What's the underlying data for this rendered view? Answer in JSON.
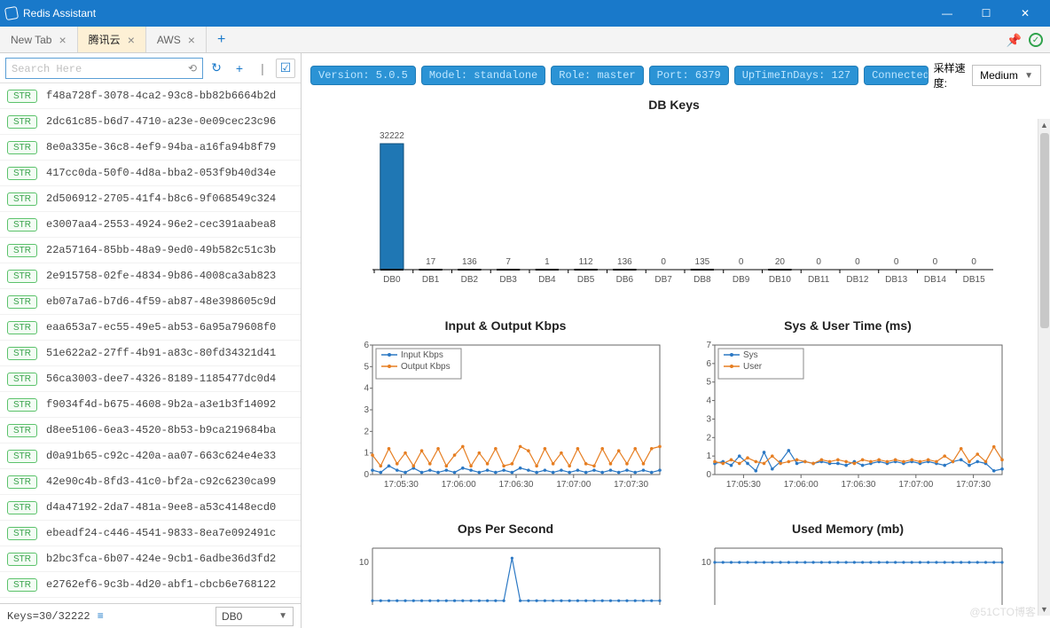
{
  "window": {
    "title": "Redis Assistant"
  },
  "tabs": [
    {
      "label": "New Tab",
      "active": false
    },
    {
      "label": "腾讯云",
      "active": true
    },
    {
      "label": "AWS",
      "active": false
    }
  ],
  "search": {
    "placeholder": "Search Here"
  },
  "keys_type_tag": "STR",
  "keys": [
    "f48a728f-3078-4ca2-93c8-bb82b6664b2d",
    "2dc61c85-b6d7-4710-a23e-0e09cec23c96",
    "8e0a335e-36c8-4ef9-94ba-a16fa94b8f79",
    "417cc0da-50f0-4d8a-bba2-053f9b40d34e",
    "2d506912-2705-41f4-b8c6-9f068549c324",
    "e3007aa4-2553-4924-96e2-cec391aabea8",
    "22a57164-85bb-48a9-9ed0-49b582c51c3b",
    "2e915758-02fe-4834-9b86-4008ca3ab823",
    "eb07a7a6-b7d6-4f59-ab87-48e398605c9d",
    "eaa653a7-ec55-49e5-ab53-6a95a79608f0",
    "51e622a2-27ff-4b91-a83c-80fd34321d41",
    "56ca3003-dee7-4326-8189-1185477dc0d4",
    "f9034f4d-b675-4608-9b2a-a3e1b3f14092",
    "d8ee5106-6ea3-4520-8b53-b9ca219684ba",
    "d0a91b65-c92c-420a-aa07-663c624e4e33",
    "42e90c4b-8fd3-41c0-bf2a-c92c6230ca99",
    "d4a47192-2da7-481a-9ee8-a53c4148ecd0",
    "ebeadf24-c446-4541-9833-8ea7e092491c",
    "b2bc3fca-6b07-424e-9cb1-6adbe36d3fd2",
    "e2762ef6-9c3b-4d20-abf1-cbcb6e768122"
  ],
  "status": {
    "keys_label": "Keys=30/32222",
    "db_selected": "DB0"
  },
  "badges": {
    "version": "Version: 5.0.5",
    "model": "Model: standalone",
    "role": "Role: master",
    "port": "Port: 6379",
    "uptime": "UpTimeInDays: 127",
    "connected": "ConnectedCli"
  },
  "sample": {
    "label": "采样速度:",
    "value": "Medium"
  },
  "charts": {
    "dbkeys": {
      "title": "DB Keys",
      "type": "bar",
      "categories": [
        "DB0",
        "DB1",
        "DB2",
        "DB3",
        "DB4",
        "DB5",
        "DB6",
        "DB7",
        "DB8",
        "DB9",
        "DB10",
        "DB11",
        "DB12",
        "DB13",
        "DB14",
        "DB15"
      ],
      "values": [
        32222,
        17,
        136,
        7,
        1,
        112,
        136,
        0,
        135,
        0,
        20,
        0,
        0,
        0,
        0,
        0
      ]
    },
    "io": {
      "title": "Input & Output Kbps",
      "type": "line",
      "x_ticks": [
        "17:05:30",
        "17:06:00",
        "17:06:30",
        "17:07:00",
        "17:07:30"
      ],
      "ylim": [
        0,
        6
      ],
      "series": [
        {
          "name": "Input Kbps",
          "color": "#2B78C4",
          "values": [
            0.2,
            0.1,
            0.4,
            0.2,
            0.1,
            0.3,
            0.1,
            0.2,
            0.1,
            0.2,
            0.1,
            0.3,
            0.2,
            0.1,
            0.2,
            0.1,
            0.2,
            0.1,
            0.3,
            0.2,
            0.1,
            0.2,
            0.1,
            0.2,
            0.1,
            0.2,
            0.1,
            0.2,
            0.1,
            0.2,
            0.1,
            0.2,
            0.1,
            0.2,
            0.1,
            0.2
          ]
        },
        {
          "name": "Output Kbps",
          "color": "#E67E22",
          "values": [
            0.9,
            0.4,
            1.2,
            0.5,
            1.0,
            0.4,
            1.1,
            0.5,
            1.2,
            0.4,
            0.9,
            1.3,
            0.4,
            1.0,
            0.5,
            1.2,
            0.4,
            0.5,
            1.3,
            1.1,
            0.4,
            1.2,
            0.5,
            1.0,
            0.4,
            1.2,
            0.5,
            0.4,
            1.2,
            0.5,
            1.1,
            0.5,
            1.2,
            0.5,
            1.2,
            1.3
          ]
        }
      ]
    },
    "cpu": {
      "title": "Sys & User Time (ms)",
      "type": "line",
      "x_ticks": [
        "17:05:30",
        "17:06:00",
        "17:06:30",
        "17:07:00",
        "17:07:30"
      ],
      "ylim": [
        0,
        7
      ],
      "series": [
        {
          "name": "Sys",
          "color": "#2B78C4",
          "values": [
            0.6,
            0.7,
            0.5,
            1.0,
            0.6,
            0.2,
            1.2,
            0.3,
            0.7,
            1.3,
            0.6,
            0.7,
            0.6,
            0.7,
            0.6,
            0.6,
            0.5,
            0.7,
            0.5,
            0.6,
            0.7,
            0.6,
            0.7,
            0.6,
            0.7,
            0.6,
            0.7,
            0.6,
            0.5,
            0.7,
            0.8,
            0.5,
            0.7,
            0.6,
            0.2,
            0.3
          ]
        },
        {
          "name": "User",
          "color": "#E67E22",
          "values": [
            0.7,
            0.6,
            0.8,
            0.6,
            0.9,
            0.7,
            0.6,
            1.0,
            0.6,
            0.7,
            0.8,
            0.7,
            0.6,
            0.8,
            0.7,
            0.8,
            0.7,
            0.6,
            0.8,
            0.7,
            0.8,
            0.7,
            0.8,
            0.7,
            0.8,
            0.7,
            0.8,
            0.7,
            1.0,
            0.7,
            1.4,
            0.7,
            1.1,
            0.7,
            1.5,
            0.8
          ]
        }
      ]
    },
    "ops": {
      "title": "Ops Per Second",
      "type": "line",
      "y_ticks": [
        10
      ],
      "values": [
        1,
        1,
        1,
        1,
        1,
        1,
        1,
        1,
        1,
        1,
        1,
        1,
        1,
        1,
        1,
        1,
        1,
        11,
        1,
        1,
        1,
        1,
        1,
        1,
        1,
        1,
        1,
        1,
        1,
        1,
        1,
        1,
        1,
        1,
        1,
        1
      ],
      "color": "#2B78C4"
    },
    "mem": {
      "title": "Used Memory (mb)",
      "type": "line",
      "y_ticks": [
        10
      ],
      "values": [
        10,
        10,
        10,
        10,
        10,
        10,
        10,
        10,
        10,
        10,
        10,
        10,
        10,
        10,
        10,
        10,
        10,
        10,
        10,
        10,
        10,
        10,
        10,
        10,
        10,
        10,
        10,
        10,
        10,
        10,
        10,
        10,
        10,
        10,
        10,
        10
      ],
      "color": "#2B78C4"
    }
  },
  "watermark": "@51CTO博客"
}
